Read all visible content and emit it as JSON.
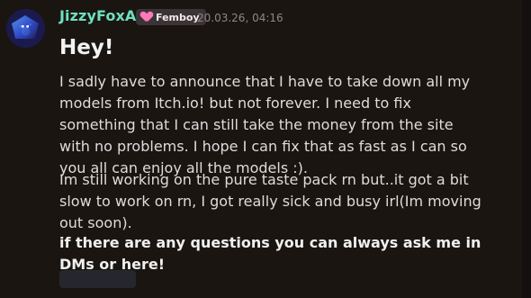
{
  "user": {
    "name": "JizzyFoxAD",
    "badge": "Femboy",
    "timestamp": "20.03.26, 04:16"
  },
  "message": {
    "title": "Hey!",
    "paragraphs": [
      "I sadly have to announce that I have to take down all my models from Itch.io! but not forever. I need to fix something that I can still take the money from the site with no problems. I hope I can fix that as fast as I can so you all can enjoy all the models :).",
      "Im still working on the pure taste pack rn but..it got a bit slow to work on rn, I got really sick and busy irl(Im moving out soon).",
      "if there are any questions you can always ask me in DMs or here!"
    ]
  },
  "colors": {
    "username": "#6ce0bf",
    "badge_heart": "#ff78b8",
    "background": "#1b1511"
  },
  "icons": {
    "avatar": "fox-avatar-icon",
    "badge_icon": "heart-icon"
  }
}
